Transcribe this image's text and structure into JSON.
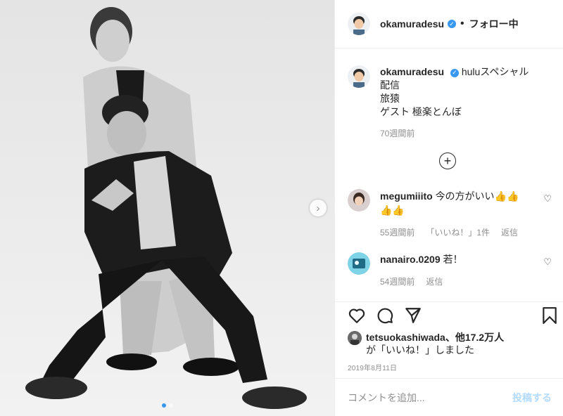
{
  "post": {
    "username": "okamuradesu",
    "follow_separator": "•",
    "follow_status": "フォロー中",
    "caption_lines": [
      "huluスペシャル配信",
      "旅猿",
      "ゲスト 極楽とんぼ"
    ],
    "caption_time": "70週間前",
    "load_more_icon": "plus-circle-icon"
  },
  "comments": [
    {
      "username": "megumiiito",
      "text": "今の方がいい👍👍👍👍",
      "time": "55週間前",
      "likes": "「いいね！」1件",
      "reply": "返信"
    },
    {
      "username": "nanairo.0209",
      "text": "若！",
      "time": "54週間前",
      "reply": "返信"
    }
  ],
  "likes": {
    "user": "tetsuokashiwada",
    "rest": "、他17.2万人",
    "line2": "が「いいね！」しました"
  },
  "date": "2019年8月11日",
  "add_comment": {
    "placeholder": "コメントを追加...",
    "post_label": "投稿する"
  },
  "colors": {
    "accent": "#3897f0",
    "muted": "#8e8e8e",
    "post_disabled": "#b3dbff"
  }
}
